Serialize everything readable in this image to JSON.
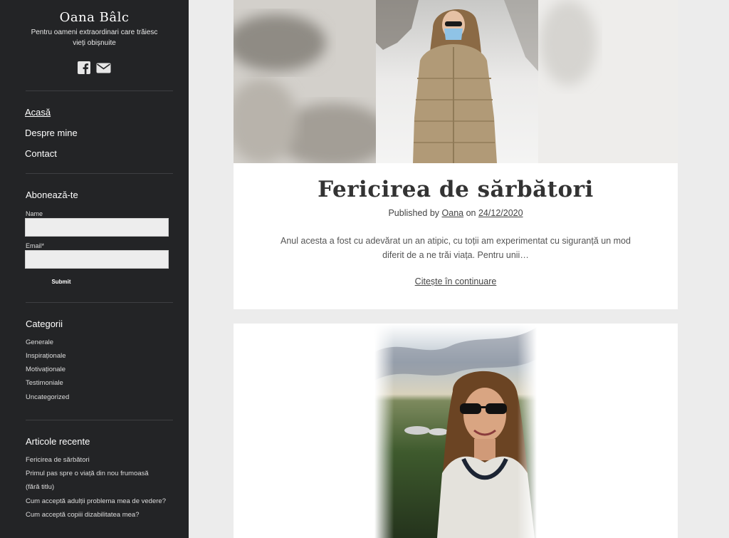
{
  "site": {
    "title": "Oana Bâlc",
    "description": "Pentru oameni extraordinari care trăiesc vieți obișnuite"
  },
  "social": [
    {
      "icon": "facebook-icon"
    },
    {
      "icon": "mail-icon"
    }
  ],
  "nav": {
    "items": [
      {
        "label": "Acasă"
      },
      {
        "label": "Despre mine"
      },
      {
        "label": "Contact"
      }
    ]
  },
  "subscribe": {
    "title": "Abonează-te",
    "name_label": "Name",
    "name_value": "",
    "email_label": "Email*",
    "email_value": "",
    "submit_label": "Submit"
  },
  "categories": {
    "title": "Categorii",
    "items": [
      "Generale",
      "Inspiraționale",
      "Motivaționale",
      "Testimoniale",
      "Uncategorized"
    ]
  },
  "recent": {
    "title": "Articole recente",
    "items": [
      "Fericirea de sărbători",
      "Primul pas spre o viață din nou frumoasă",
      "(fără titlu)",
      "Cum acceptă adulții problema mea de vedere?",
      "Cum acceptă copiii dizabilitatea mea?"
    ]
  },
  "posts": [
    {
      "title": "Fericirea de sărbători",
      "published_by": "Published by",
      "author": "Oana",
      "on": "on",
      "date": "24/12/2020",
      "excerpt": "Anul acesta a fost cu adevărat un an atipic, cu toții am experimentat cu siguranță un mod diferit de a ne trăi viața. Pentru unii…",
      "read_more": "Citește în continuare"
    }
  ],
  "colors": {
    "sidebar_bg": "#232426",
    "page_bg": "#ececec",
    "card_bg": "#ffffff",
    "text": "#333333"
  }
}
